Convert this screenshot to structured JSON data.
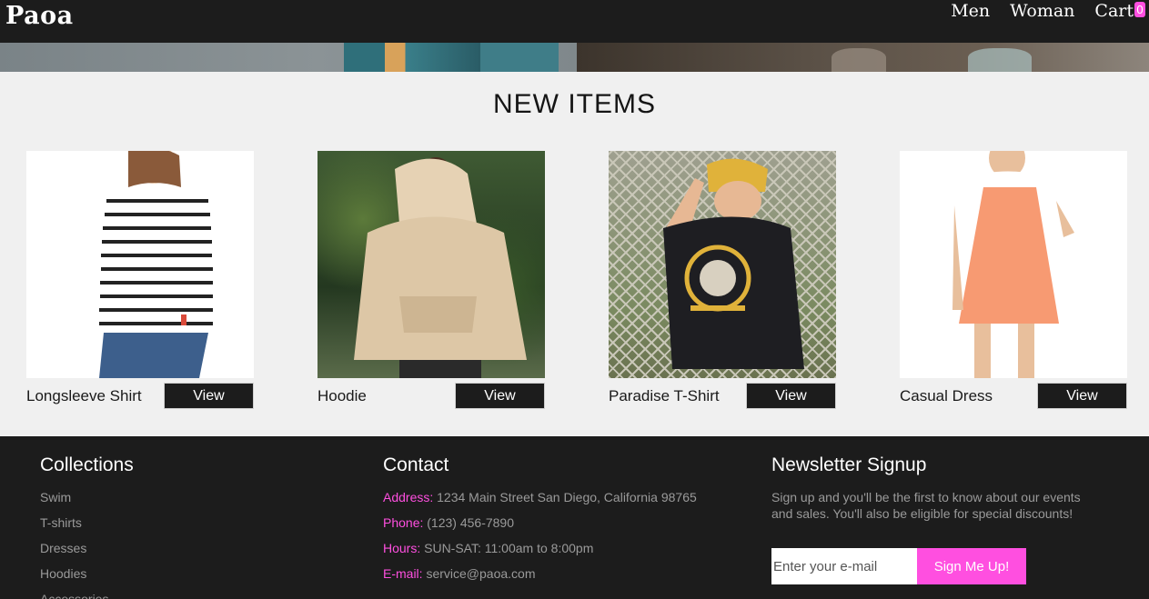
{
  "header": {
    "logo": "Paoa",
    "nav": {
      "men": "Men",
      "woman": "Woman",
      "cart": "Cart",
      "cart_count": "0"
    }
  },
  "new_items": {
    "title": "NEW ITEMS",
    "products": [
      {
        "name": "Longsleeve Shirt",
        "button": "View"
      },
      {
        "name": "Hoodie",
        "button": "View"
      },
      {
        "name": "Paradise T-Shirt",
        "button": "View"
      },
      {
        "name": "Casual Dress",
        "button": "View"
      }
    ]
  },
  "footer": {
    "collections": {
      "title": "Collections",
      "items": [
        "Swim",
        "T-shirts",
        "Dresses",
        "Hoodies",
        "Accessories"
      ]
    },
    "contact": {
      "title": "Contact",
      "address_label": "Address:",
      "address": "1234 Main Street San Diego, California 98765",
      "phone_label": "Phone:",
      "phone": "(123) 456-7890",
      "hours_label": "Hours:",
      "hours": "SUN-SAT: 11:00am to 8:00pm",
      "email_label": "E-mail:",
      "email": "service@paoa.com"
    },
    "newsletter": {
      "title": "Newsletter Signup",
      "text": "Sign up and you'll be the first to know about our events and sales. You'll also be eligible for special discounts!",
      "placeholder": "Enter your e-mail",
      "button": "Sign Me Up!"
    }
  },
  "colors": {
    "accent": "#ff4fe0",
    "dark": "#1c1c1c",
    "background": "#f0f0f0"
  }
}
